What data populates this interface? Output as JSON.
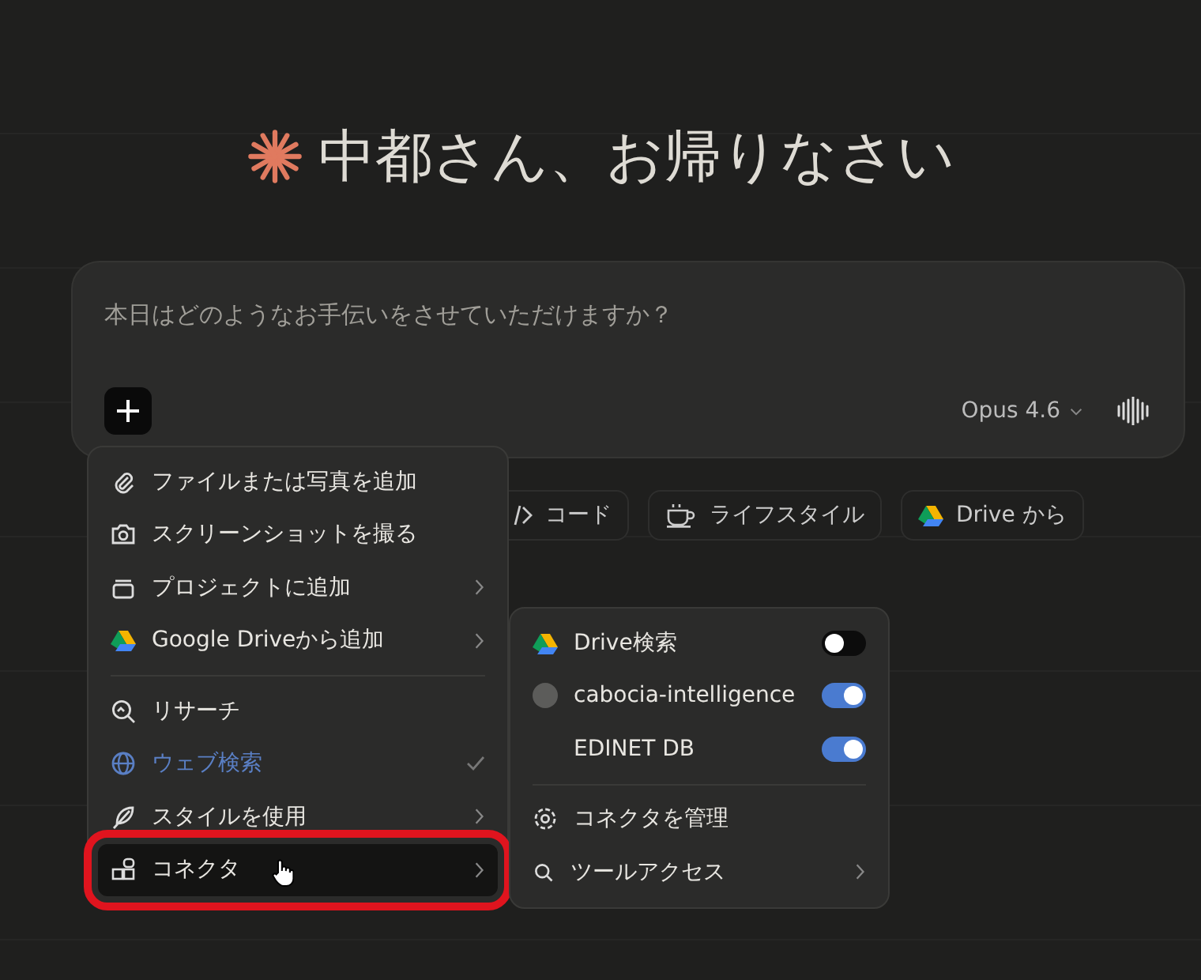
{
  "greeting": {
    "title": "中都さん、お帰りなさい"
  },
  "composer": {
    "placeholder": "本日はどのようなお手伝いをさせていただけますか？",
    "model": "Opus 4.6"
  },
  "chips": [
    {
      "kind": "code",
      "label": "コード"
    },
    {
      "kind": "lifestyle",
      "label": "ライフスタイル"
    },
    {
      "kind": "drive",
      "label": "Drive から"
    }
  ],
  "menu": {
    "sections": [
      [
        {
          "kind": "clip",
          "label": "ファイルまたは写真を追加",
          "submenu": false,
          "checked": false,
          "selected": false,
          "highlighted": false
        },
        {
          "kind": "camera",
          "label": "スクリーンショットを撮る",
          "submenu": false,
          "checked": false,
          "selected": false,
          "highlighted": false
        },
        {
          "kind": "box",
          "label": "プロジェクトに追加",
          "submenu": true,
          "checked": false,
          "selected": false,
          "highlighted": false
        },
        {
          "kind": "drive",
          "label": "Google Driveから追加",
          "submenu": true,
          "checked": false,
          "selected": false,
          "highlighted": false
        }
      ],
      [
        {
          "kind": "research",
          "label": "リサーチ",
          "submenu": false,
          "checked": false,
          "selected": false,
          "highlighted": false
        },
        {
          "kind": "globe",
          "label": "ウェブ検索",
          "submenu": false,
          "checked": true,
          "selected": false,
          "highlighted": false
        },
        {
          "kind": "feather",
          "label": "スタイルを使用",
          "submenu": true,
          "checked": false,
          "selected": false,
          "highlighted": false
        },
        {
          "kind": "connector",
          "label": "コネクタ",
          "submenu": true,
          "checked": false,
          "selected": true,
          "highlighted": true
        }
      ]
    ]
  },
  "submenu": {
    "connectors": [
      {
        "kind": "drive",
        "label": "Drive検索",
        "on": false
      },
      {
        "kind": "avatar",
        "label": "cabocia-intelligence",
        "on": true
      },
      {
        "kind": "none",
        "label": "EDINET DB",
        "on": true
      }
    ],
    "actions": [
      {
        "kind": "gear",
        "label": "コネクタを管理",
        "submenu": false
      },
      {
        "kind": "search",
        "label": "ツールアクセス",
        "submenu": true
      }
    ]
  }
}
